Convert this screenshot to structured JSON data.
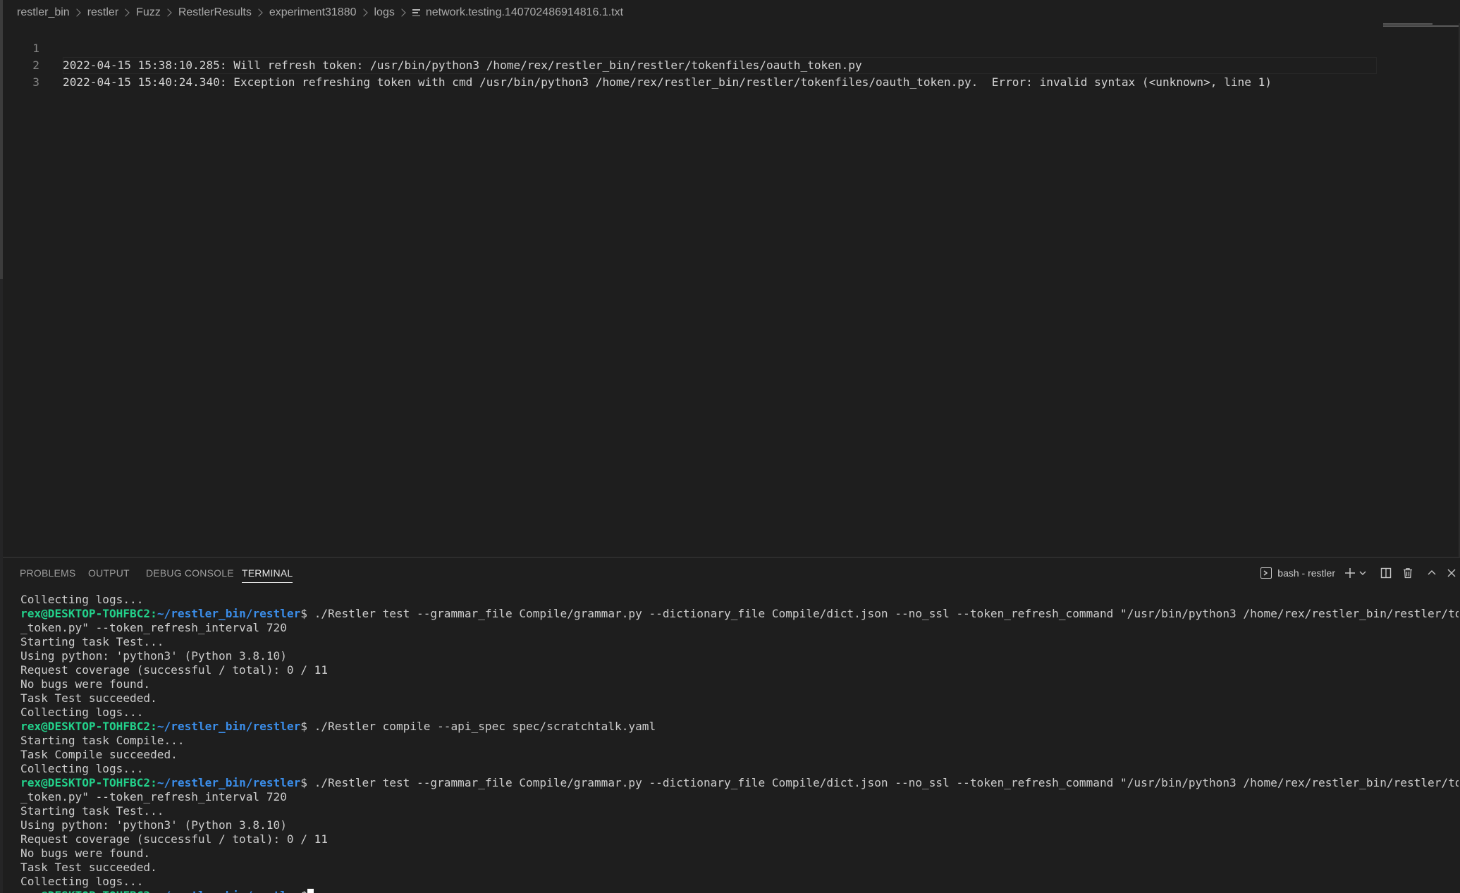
{
  "breadcrumb": {
    "items": [
      "restler_bin",
      "restler",
      "Fuzz",
      "RestlerResults",
      "experiment31880",
      "logs"
    ],
    "file": "network.testing.140702486914816.1.txt",
    "file_icon": "lines-file-icon"
  },
  "editor": {
    "lines": [
      {
        "number": "1",
        "text": "2022-04-15 15:38:10.285: Will refresh token: /usr/bin/python3 /home/rex/restler_bin/restler/tokenfiles/oauth_token.py"
      },
      {
        "number": "2",
        "text": "2022-04-15 15:40:24.340: Exception refreshing token with cmd /usr/bin/python3 /home/rex/restler_bin/restler/tokenfiles/oauth_token.py.  Error: invalid syntax (<unknown>, line 1)"
      },
      {
        "number": "3",
        "text": ""
      }
    ]
  },
  "panel": {
    "tabs": [
      "PROBLEMS",
      "OUTPUT",
      "DEBUG CONSOLE",
      "TERMINAL"
    ],
    "active_tab": "TERMINAL",
    "terminal_selector": "bash - restler",
    "actions": [
      "new-terminal-icon",
      "chevron-down-icon",
      "split-terminal-icon",
      "trash-icon",
      "maximize-chevron-up-icon",
      "close-icon"
    ]
  },
  "terminal": {
    "prompt_user": "rex@DESKTOP-TOHFBC2",
    "prompt_path": "~/restler_bin/restler",
    "prompt_symbol": "$",
    "lines": [
      {
        "text": "Collecting logs..."
      },
      {
        "prompt": true,
        "text": " ./Restler test --grammar_file Compile/grammar.py --dictionary_file Compile/dict.json --no_ssl --token_refresh_command \"/usr/bin/python3 /home/rex/restler_bin/restler/tokenfiles/oauth"
      },
      {
        "text": "_token.py\" --token_refresh_interval 720"
      },
      {
        "text": "Starting task Test..."
      },
      {
        "text": "Using python: 'python3' (Python 3.8.10)"
      },
      {
        "text": "Request coverage (successful / total): 0 / 11"
      },
      {
        "text": "No bugs were found."
      },
      {
        "text": "Task Test succeeded."
      },
      {
        "text": "Collecting logs..."
      },
      {
        "prompt": true,
        "text": " ./Restler compile --api_spec spec/scratchtalk.yaml"
      },
      {
        "text": "Starting task Compile..."
      },
      {
        "text": "Task Compile succeeded."
      },
      {
        "text": "Collecting logs..."
      },
      {
        "prompt": true,
        "text": " ./Restler test --grammar_file Compile/grammar.py --dictionary_file Compile/dict.json --no_ssl --token_refresh_command \"/usr/bin/python3 /home/rex/restler_bin/restler/tokenfiles/oauth"
      },
      {
        "text": "_token.py\" --token_refresh_interval 720"
      },
      {
        "text": "Starting task Test..."
      },
      {
        "text": "Using python: 'python3' (Python 3.8.10)"
      },
      {
        "text": "Request coverage (successful / total): 0 / 11"
      },
      {
        "text": "No bugs were found."
      },
      {
        "text": "Task Test succeeded."
      },
      {
        "text": "Collecting logs..."
      },
      {
        "prompt": true,
        "text": "",
        "cursor": true
      }
    ]
  },
  "colors": {
    "background": "#1e1e1e",
    "prompt_user": "#23d18b",
    "prompt_path": "#3b8eea",
    "text": "#cccccc",
    "line_numbers": "#858585"
  }
}
